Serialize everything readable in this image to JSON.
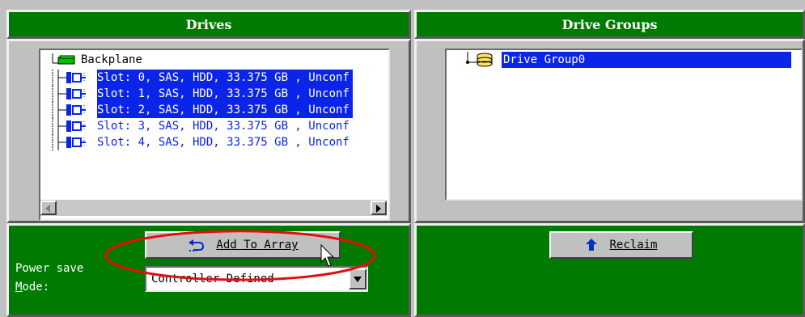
{
  "drives_panel": {
    "header": "Drives",
    "tree": {
      "root_label": "Backplane",
      "items": [
        {
          "label": "Slot: 0, SAS, HDD, 33.375 GB , Unconf",
          "selected": true
        },
        {
          "label": "Slot: 1, SAS, HDD, 33.375 GB , Unconf",
          "selected": true
        },
        {
          "label": "Slot: 2, SAS, HDD, 33.375 GB , Unconf",
          "selected": true
        },
        {
          "label": "Slot: 3, SAS, HDD, 33.375 GB , Unconf",
          "selected": false
        },
        {
          "label": "Slot: 4, SAS, HDD, 33.375 GB , Unconf",
          "selected": false
        }
      ]
    },
    "add_button": {
      "label": "Add To Array",
      "icon": "undo-arrow-icon"
    },
    "power_save": {
      "label_line1": "Power save",
      "label_line2": "Mode:",
      "value": "Controller Defined"
    }
  },
  "drive_groups_panel": {
    "header": "Drive Groups",
    "tree": {
      "items": [
        {
          "label": "Drive Group0",
          "selected": true
        }
      ]
    },
    "reclaim_button": {
      "label": "Reclaim",
      "icon": "up-arrow-icon"
    }
  },
  "colors": {
    "header_green": "#007a00",
    "selection_blue": "#0a24e8",
    "annotation_red": "#e01010"
  }
}
